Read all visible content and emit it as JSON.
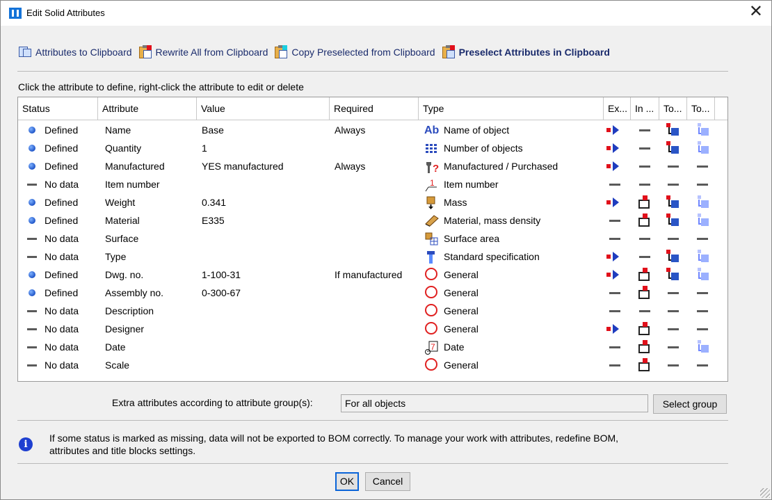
{
  "window": {
    "title": "Edit Solid Attributes",
    "close_glyph": "✕"
  },
  "toolbar": [
    {
      "label": "Attributes to Clipboard",
      "icon": "attributes-to-clipboard-icon",
      "bold": false
    },
    {
      "label": "Rewrite All from Clipboard",
      "icon": "rewrite-all-clipboard-icon",
      "bold": false
    },
    {
      "label": "Copy Preselected from Clipboard",
      "icon": "copy-preselected-clipboard-icon",
      "bold": false
    },
    {
      "label": "Preselect Attributes in Clipboard",
      "icon": "preselect-attributes-clipboard-icon",
      "bold": true
    }
  ],
  "hint": "Click the attribute to define, right-click the attribute to edit or delete",
  "columns": {
    "status": "Status",
    "attribute": "Attribute",
    "value": "Value",
    "required": "Required",
    "type": "Type",
    "export": "Ex...",
    "in": "In ...",
    "to1": "To...",
    "to2": "To..."
  },
  "rows": [
    {
      "status": "Defined",
      "attribute": "Name",
      "value": "Base",
      "required": "Always",
      "type": "Name of object",
      "type_icon": "text-ab-icon",
      "export": true,
      "in": false,
      "to1": true,
      "to2": true
    },
    {
      "status": "Defined",
      "attribute": "Quantity",
      "value": "1",
      "required": "",
      "type": "Number of objects",
      "type_icon": "grid-number-icon",
      "export": true,
      "in": false,
      "to1": true,
      "to2": true
    },
    {
      "status": "Defined",
      "attribute": "Manufactured",
      "value": "YES manufactured",
      "required": "Always",
      "type": "Manufactured / Purchased",
      "type_icon": "wrench-question-icon",
      "export": true,
      "in": false,
      "to1": false,
      "to2": false
    },
    {
      "status": "No data",
      "attribute": "Item number",
      "value": "",
      "required": "",
      "type": "Item number",
      "type_icon": "item-number-icon",
      "export": false,
      "in": false,
      "to1": false,
      "to2": false
    },
    {
      "status": "Defined",
      "attribute": "Weight",
      "value": "0.341",
      "required": "",
      "type": "Mass",
      "type_icon": "mass-icon",
      "export": true,
      "in": true,
      "to1": true,
      "to2": true
    },
    {
      "status": "Defined",
      "attribute": "Material",
      "value": "E335",
      "required": "",
      "type": "Material, mass density",
      "type_icon": "material-icon",
      "export": false,
      "in": true,
      "to1": true,
      "to2": true
    },
    {
      "status": "No data",
      "attribute": "Surface",
      "value": "",
      "required": "",
      "type": "Surface area",
      "type_icon": "surface-area-icon",
      "export": false,
      "in": false,
      "to1": false,
      "to2": false
    },
    {
      "status": "No data",
      "attribute": "Type",
      "value": "",
      "required": "",
      "type": "Standard specification",
      "type_icon": "standard-spec-icon",
      "export": true,
      "in": false,
      "to1": true,
      "to2": true
    },
    {
      "status": "Defined",
      "attribute": "Dwg. no.",
      "value": "1-100-31",
      "required": "If manufactured",
      "type": "General",
      "type_icon": "general-circle-icon",
      "export": true,
      "in": true,
      "to1": true,
      "to2": true
    },
    {
      "status": "Defined",
      "attribute": "Assembly no.",
      "value": "0-300-67",
      "required": "",
      "type": "General",
      "type_icon": "general-circle-icon",
      "export": false,
      "in": true,
      "to1": false,
      "to2": false
    },
    {
      "status": "No data",
      "attribute": "Description",
      "value": "",
      "required": "",
      "type": "General",
      "type_icon": "general-circle-icon",
      "export": false,
      "in": false,
      "to1": false,
      "to2": false
    },
    {
      "status": "No data",
      "attribute": "Designer",
      "value": "",
      "required": "",
      "type": "General",
      "type_icon": "general-circle-icon",
      "export": true,
      "in": true,
      "to1": false,
      "to2": false
    },
    {
      "status": "No data",
      "attribute": "Date",
      "value": "",
      "required": "",
      "type": "Date",
      "type_icon": "calendar-date-icon",
      "export": false,
      "in": true,
      "to1": false,
      "to2": true
    },
    {
      "status": "No data",
      "attribute": "Scale",
      "value": "",
      "required": "",
      "type": "General",
      "type_icon": "general-circle-icon",
      "export": false,
      "in": true,
      "to1": false,
      "to2": false
    }
  ],
  "extra": {
    "label": "Extra attributes according to attribute group(s):",
    "value": "For all objects",
    "button": "Select group"
  },
  "info": "If some status is marked as missing, data will not be exported to BOM correctly. To manage your work with attributes, redefine BOM, attributes and title blocks settings.",
  "buttons": {
    "ok": "OK",
    "cancel": "Cancel"
  }
}
